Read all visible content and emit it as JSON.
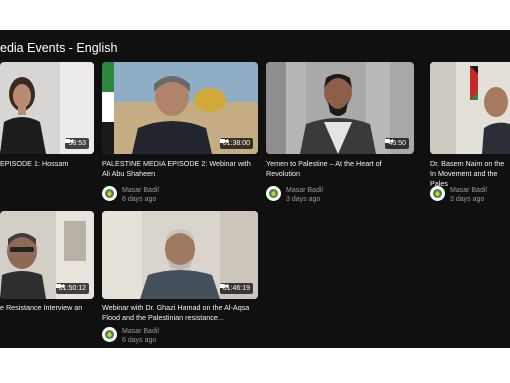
{
  "section": {
    "title": "edia Events - English"
  },
  "colors": {
    "background": "#101010",
    "text": "#f2f2f2",
    "muted": "#9a9a9a"
  },
  "videos": [
    {
      "title": "EPISODE 1: Hossam",
      "duration": "58:53",
      "channel": "",
      "age": ""
    },
    {
      "title": "PALESTINE MEDIA EPISODE 2: Webinar with Ali Abu Shaheen",
      "duration": "01:38:00",
      "channel": "Masar Badil",
      "age": "6 days ago"
    },
    {
      "title": "Yemen to Palestine – At the Heart of Revolution",
      "duration": "45:50",
      "channel": "Masar Badil",
      "age": "3 days ago"
    },
    {
      "title": "Dr. Basem Naim on the In Movement and the Pales",
      "duration": "",
      "channel": "Masar Badil",
      "age": "3 days ago"
    },
    {
      "title": "e Resistance Interview an",
      "duration": "01:50:12",
      "channel": "",
      "age": ""
    },
    {
      "title": "Webinar with Dr. Ghazi Hamad on the Al-Aqsa Flood and the Palestinian resistance...",
      "duration": "01:46:19",
      "channel": "Masar Badil",
      "age": "6 days ago"
    }
  ]
}
